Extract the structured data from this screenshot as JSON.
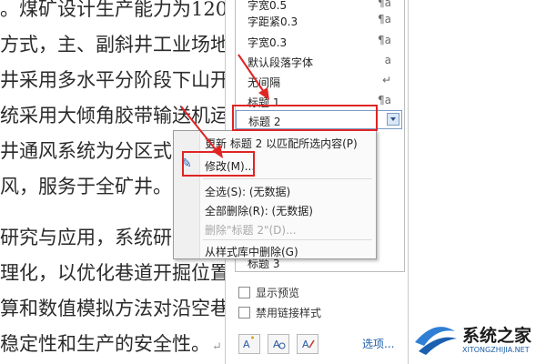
{
  "document": {
    "lines": [
      "。煤矿设计生产能力为120",
      "方式，主、副斜井工业场地",
      "井采用多水平分阶段下山开",
      "统采用大倾角胶带输送机运",
      "井通风系统为分区式通",
      "风，服务于全矿井。",
      "研究与应用，系统研究",
      "理化，以优化巷道开掘位置",
      "算和数值模拟方法对沿空巷",
      "稳定性和生产的安全性。"
    ],
    "paragraph_mark": "↵"
  },
  "styles_pane": {
    "items": [
      {
        "name": "字宽0.5",
        "mark": "¶a"
      },
      {
        "name": "字距紧0.3",
        "mark": "¶a"
      },
      {
        "name": "字宽0.3",
        "mark": "¶a"
      },
      {
        "name": "默认段落字体",
        "mark": "a"
      },
      {
        "name": "无间隔",
        "mark": "↵"
      },
      {
        "name": "标题 1",
        "mark": "¶a"
      },
      {
        "name": "标题 2",
        "mark": ""
      }
    ],
    "partial_item": "标题 3",
    "show_preview": "显示预览",
    "disable_linked": "禁用链接样式",
    "options": "选项..."
  },
  "context_menu": {
    "update": "更新 标题 2 以匹配所选内容(P)",
    "modify": "修改(M)...",
    "select_all": "全选(S): (无数据)",
    "delete_all": "全部删除(R): (无数据)",
    "delete_style": "删除\"标题 2\"(D)...",
    "remove_from_gallery": "从样式库中删除(G)"
  },
  "watermark": {
    "title": "系统之家",
    "url": "XITONGZHIJIA.NET"
  },
  "colors": {
    "highlight": "#e02424",
    "link": "#1d5fa8"
  }
}
